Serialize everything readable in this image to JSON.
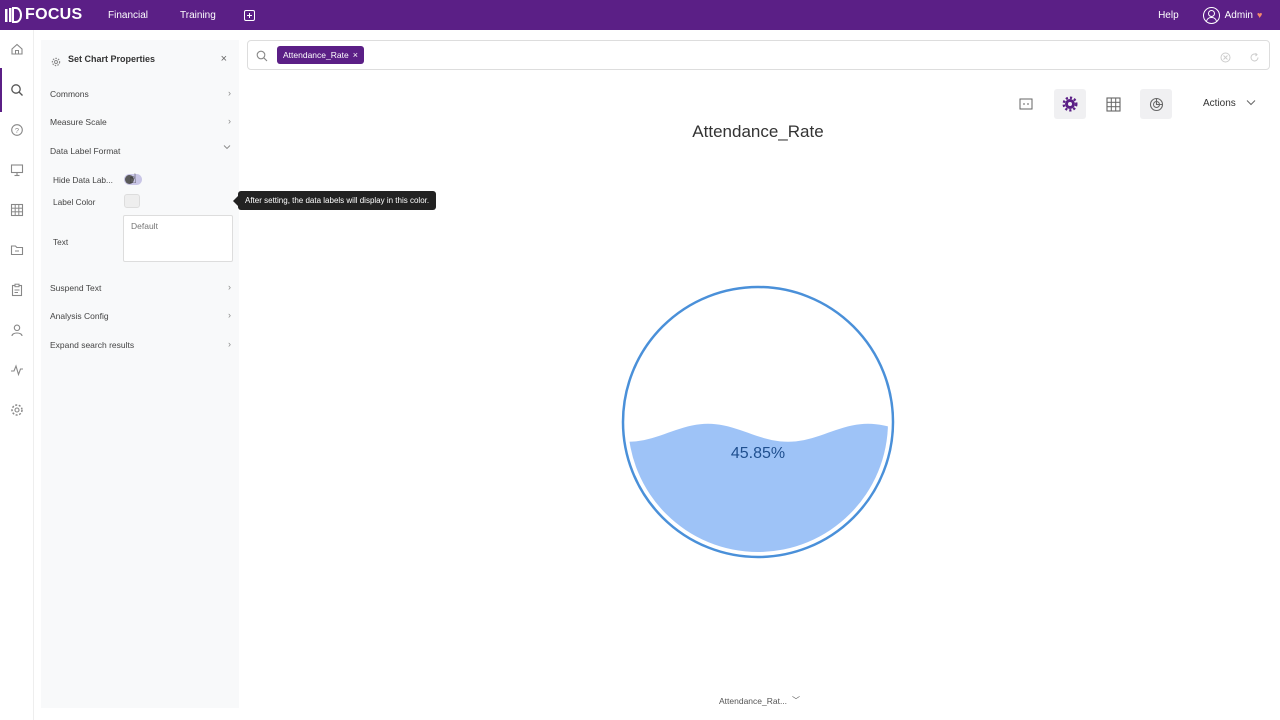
{
  "app": {
    "brand": "FOCUS",
    "nav": [
      {
        "label": "Financial"
      },
      {
        "label": "Training"
      }
    ],
    "help_label": "Help",
    "user_label": "Admin"
  },
  "rail": {
    "icons": [
      "home-icon",
      "search-icon",
      "question-icon",
      "presentation-icon",
      "table-icon",
      "folder-icon",
      "clipboard-icon",
      "user-icon",
      "activity-icon",
      "settings-icon"
    ]
  },
  "panel": {
    "title": "Set Chart Properties",
    "sections": [
      {
        "label": "Commons",
        "expanded": false
      },
      {
        "label": "Measure Scale",
        "expanded": false
      },
      {
        "label": "Data Label Format",
        "expanded": true
      },
      {
        "label": "Suspend Text",
        "expanded": false
      },
      {
        "label": "Analysis Config",
        "expanded": false
      },
      {
        "label": "Expand search results",
        "expanded": false
      }
    ],
    "data_label_format": {
      "hide_label": "Hide Data Lab...",
      "hide_value": true,
      "color_label": "Label Color",
      "text_label": "Text",
      "text_placeholder": "Default"
    }
  },
  "tooltip": {
    "text": "After setting, the data labels will display in this color."
  },
  "search": {
    "tokens": [
      "Attendance_Rate"
    ]
  },
  "toolbar": {
    "tools": [
      "layout-icon",
      "settings-icon",
      "table-icon",
      "chart-type-icon"
    ],
    "active_tools": [
      "settings-icon",
      "chart-type-icon"
    ],
    "actions_label": "Actions"
  },
  "chart_data": {
    "type": "liquid-fill",
    "title": "Attendance_Rate",
    "value": 0.4585,
    "value_label": "45.85%",
    "series_name": "Attendance_Rate",
    "fill_color": "#9ec3f7",
    "outline_color": "#4a90d9",
    "label_color": "#1f4f8f",
    "axis_selector_label": "Attendance_Rat..."
  },
  "colors": {
    "brand": "#5b1f86",
    "panel_bg": "#f8f9fa"
  }
}
